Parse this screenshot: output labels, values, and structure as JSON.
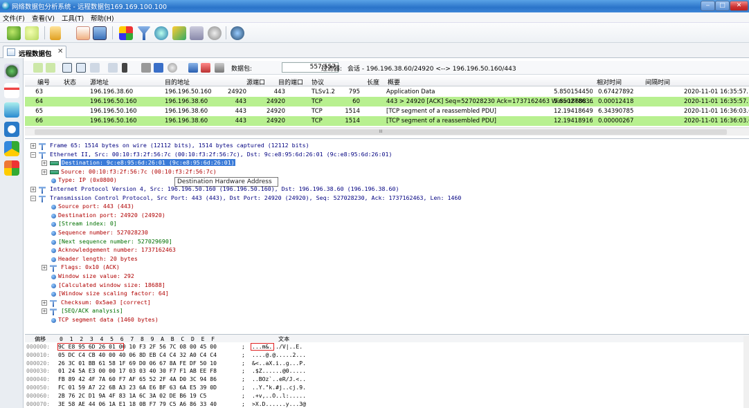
{
  "window": {
    "title": "网络数据包分析系统 - 远程数据包169.169.100.100",
    "min": "‒",
    "max": "□",
    "close": "✕"
  },
  "menu": [
    "文件(F)",
    "查看(V)",
    "工具(T)",
    "帮助(H)"
  ],
  "tab": {
    "label": "远程数据包",
    "close": "✕"
  },
  "packet_toolbar": {
    "count_label": "数据包:",
    "count_value": "557/557",
    "filter_label": "过滤器:",
    "filter_text": "会话 - 196.196.38.60/24920 <--> 196.196.50.160/443"
  },
  "columns": [
    "编号",
    "状态",
    "源地址",
    "目的地址",
    "源端口",
    "目的端口",
    "协议",
    "长度",
    "概要",
    "相对时间",
    "间隔时间"
  ],
  "rows": [
    {
      "no": "63",
      "src": "196.196.38.60",
      "dst": "196.196.50.160",
      "sport": "24920",
      "dport": "443",
      "proto": "TLSv1.2",
      "len": "795",
      "summary": "Application Data",
      "rel": "5.850154450",
      "gap": "0.674278922",
      "time": "2020-11-01 16:35:57.1",
      "hl": false
    },
    {
      "no": "64",
      "src": "196.196.50.160",
      "dst": "196.196.38.60",
      "sport": "443",
      "dport": "24920",
      "proto": "TCP",
      "len": "60",
      "summary": "443 > 24920 [ACK] Seq=527028230 Ack=1737162463 Win=18688 ...",
      "rel": "5.850278636",
      "gap": "0.000124186",
      "time": "2020-11-01 16:35:57.1",
      "hl": true
    },
    {
      "no": "65",
      "src": "196.196.50.160",
      "dst": "196.196.38.60",
      "sport": "443",
      "dport": "24920",
      "proto": "TCP",
      "len": "1514",
      "summary": "[TCP segment of a reassembled PDU]",
      "rel": "12.194186493",
      "gap": "6.343907857",
      "time": "2020-11-01 16:36:03.(",
      "hl": false
    },
    {
      "no": "66",
      "src": "196.196.50.160",
      "dst": "196.196.38.60",
      "sport": "443",
      "dport": "24920",
      "proto": "TCP",
      "len": "1514",
      "summary": "[TCP segment of a reassembled PDU]",
      "rel": "12.194189165",
      "gap": "0.000002672",
      "time": "2020-11-01 16:36:03.(",
      "hl": true
    }
  ],
  "scroll_mark": "III",
  "tree": [
    {
      "text": "Frame 65: 1514 bytes on wire (12112 bits), 1514 bytes captured (12112 bits)",
      "c": "",
      "ex": "+"
    },
    {
      "text": "Ethernet II, Src: 00:10:f3:2f:56:7c (00:10:f3:2f:56:7c), Dst: 9c:e8:95:6d:26:01 (9c:e8:95:6d:26:01)",
      "c": "",
      "ex": "-"
    },
    {
      "text": "Destination: 9c:e8:95:6d:26:01 (9c:e8:95:6d:26:01)",
      "c": "sel",
      "ex": "+"
    },
    {
      "text": "Source: 00:10:f3:2f:56:7c (00:10:f3:2f:56:7c)",
      "c": "red",
      "ex": "+"
    },
    {
      "text": "Type: IP (0x0800)",
      "c": "red",
      "ex": ""
    },
    {
      "text": "Internet Protocol Version 4, Src: 196.196.50.160 (196.196.50.160), Dst: 196.196.38.60 (196.196.38.60)",
      "c": "",
      "ex": "+"
    },
    {
      "text": "Transmission Control Protocol, Src Port: 443 (443), Dst Port: 24920 (24920), Seq: 527028230, Ack: 1737162463, Len: 1460",
      "c": "",
      "ex": "-"
    },
    {
      "text": "Source port: 443 (443)",
      "c": "red",
      "ex": ""
    },
    {
      "text": "Destination port: 24920 (24920)",
      "c": "red",
      "ex": ""
    },
    {
      "text": "[Stream index: 0]",
      "c": "grn",
      "ex": ""
    },
    {
      "text": "Sequence number: 527028230",
      "c": "red",
      "ex": ""
    },
    {
      "text": "[Next sequence number: 527029690]",
      "c": "grn",
      "ex": ""
    },
    {
      "text": "Acknowledgement number: 1737162463",
      "c": "red",
      "ex": ""
    },
    {
      "text": "Header length: 20 bytes",
      "c": "red",
      "ex": ""
    },
    {
      "text": "Flags: 0x10 (ACK)",
      "c": "red",
      "ex": "+"
    },
    {
      "text": "Window size value: 292",
      "c": "red",
      "ex": ""
    },
    {
      "text": "[Calculated window size: 18688]",
      "c": "red",
      "ex": ""
    },
    {
      "text": "[Window size scaling factor: 64]",
      "c": "red",
      "ex": ""
    },
    {
      "text": "Checksum: 0x5ae3 [correct]",
      "c": "red",
      "ex": "+"
    },
    {
      "text": "[SEQ/ACK analysis]",
      "c": "grn",
      "ex": "+"
    },
    {
      "text": "TCP segment data (1460 bytes)",
      "c": "red",
      "ex": ""
    }
  ],
  "tooltip": "Destination Hardware Address",
  "hex": {
    "offset_label": "偏移",
    "columns": "0  1  2  3  4  5  6  7  8  9  A  B  C  D  E  F",
    "text_label": "文本",
    "rows": [
      {
        "off": "000000:",
        "bytes": "9C E8 95 6D 26 01 00 10 F3 2F 56 7C 08 00 45 00",
        "ascii": "...m&.../V|..E."
      },
      {
        "off": "000010:",
        "bytes": "05 DC C4 CB 40 00 40 06 8D EB C4 C4 32 A0 C4 C4",
        "ascii": "....@.@.....2..."
      },
      {
        "off": "000020:",
        "bytes": "26 3C 01 BB 61 58 1F 69 D0 06 67 8A FE DF 50 10",
        "ascii": "&<..aX.i..g...P."
      },
      {
        "off": "000030:",
        "bytes": "01 24 5A E3 00 00 17 03 03 40 30 F7 F1 AB EE F8",
        "ascii": ".$Z......@0....."
      },
      {
        "off": "000040:",
        "bytes": "FB 89 42 4F 7A 60 F7 AF 65 52 2F 4A D0 3C 94 86",
        "ascii": "..BOz`..eR/J.<.."
      },
      {
        "off": "000050:",
        "bytes": "FC 01 59 A7 22 6B A3 23 6A E6 BF 63 6A E5 39 0D",
        "ascii": "..Y.\"k.#j..cj.9."
      },
      {
        "off": "000060:",
        "bytes": "2B 76 2C D1 9A 4F 83 1A 6C 3A 02 DE B6 19 C5",
        "ascii": ".+v,..O..l:....."
      },
      {
        "off": "000070:",
        "bytes": "3E 58 AE 44 06 1A E1 18 0B F7 79 C5 A6 86 33 40",
        "ascii": ">X.D......y...3@"
      }
    ]
  }
}
